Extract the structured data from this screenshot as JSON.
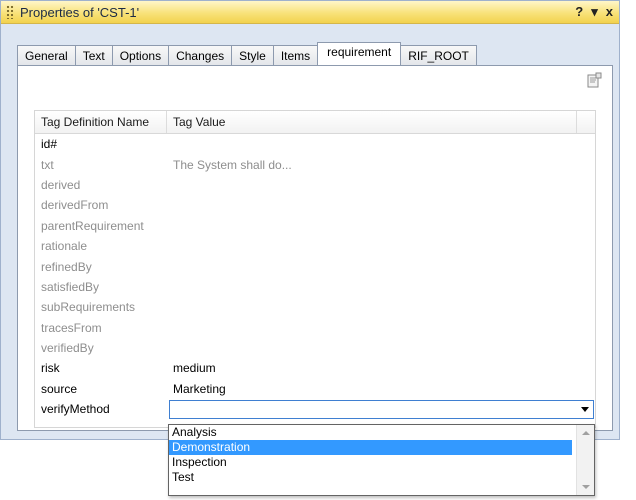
{
  "window": {
    "title": "Properties of 'CST-1'",
    "help_label": "?",
    "menu_label": "▾",
    "close_label": "x"
  },
  "tabs": [
    {
      "label": "General"
    },
    {
      "label": "Text"
    },
    {
      "label": "Options"
    },
    {
      "label": "Changes"
    },
    {
      "label": "Style"
    },
    {
      "label": "Items"
    },
    {
      "label": "requirement",
      "active": true
    },
    {
      "label": "RIF_ROOT"
    }
  ],
  "grid": {
    "header": {
      "name": "Tag Definition Name",
      "value": "Tag Value"
    },
    "rows": [
      {
        "name": "id#",
        "value": "",
        "style": "dark"
      },
      {
        "name": "txt",
        "value": "The System shall do...",
        "style": "gray"
      },
      {
        "name": "derived",
        "value": "",
        "style": "gray"
      },
      {
        "name": "derivedFrom",
        "value": "",
        "style": "gray"
      },
      {
        "name": "parentRequirement",
        "value": "",
        "style": "gray"
      },
      {
        "name": "rationale",
        "value": "",
        "style": "gray"
      },
      {
        "name": "refinedBy",
        "value": "",
        "style": "gray"
      },
      {
        "name": "satisfiedBy",
        "value": "",
        "style": "gray"
      },
      {
        "name": "subRequirements",
        "value": "",
        "style": "gray"
      },
      {
        "name": "tracesFrom",
        "value": "",
        "style": "gray"
      },
      {
        "name": "verifiedBy",
        "value": "",
        "style": "gray"
      },
      {
        "name": "risk",
        "value": "medium",
        "style": "dark"
      },
      {
        "name": "source",
        "value": "Marketing",
        "style": "dark"
      },
      {
        "name": "verifyMethod",
        "value": "",
        "style": "dark",
        "editor": "dropdown"
      }
    ]
  },
  "dropdown": {
    "options": [
      "Analysis",
      "Demonstration",
      "Inspection",
      "Test"
    ],
    "highlighted": "Demonstration"
  },
  "colors": {
    "titlebar": "#f8e27a",
    "highlight": "#3399ff",
    "inactive_text": "#8e8e8e"
  }
}
